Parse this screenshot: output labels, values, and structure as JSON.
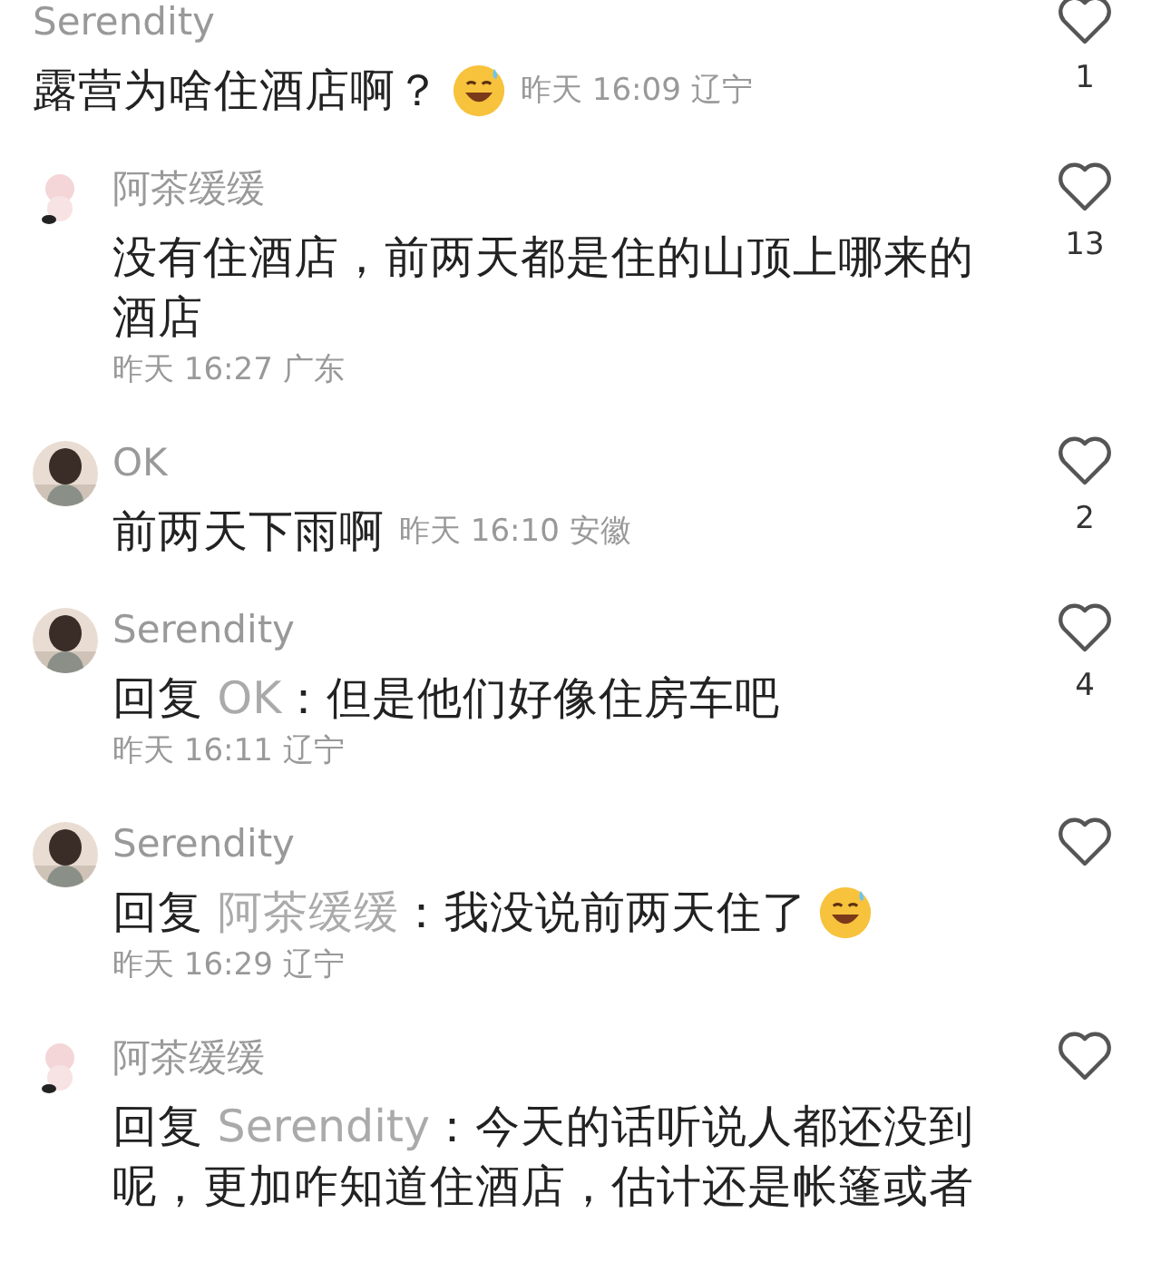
{
  "comments": [
    {
      "name": "Serendity",
      "text": "露营为啥住酒店啊？",
      "emoji": true,
      "time": "昨天 16:09 辽宁",
      "time_inline": true,
      "likes": "1"
    },
    {
      "avatar": {
        "kind": "sticker"
      },
      "name": "阿茶缓缓",
      "text": "没有住酒店，前两天都是住的山顶上哪来的酒店",
      "emoji": false,
      "time": "昨天 16:27 广东",
      "time_inline": false,
      "likes": "13"
    },
    {
      "name": "OK",
      "text": "前两天下雨啊",
      "emoji": false,
      "time": "昨天 16:10 安徽",
      "time_inline": true,
      "likes": "2"
    },
    {
      "name": "Serendity",
      "reply_label": "回复",
      "reply_to": "OK",
      "text": "：但是他们好像住房车吧",
      "emoji": false,
      "time": "昨天 16:11 辽宁",
      "time_inline": false,
      "likes": "4"
    },
    {
      "name": "Serendity",
      "reply_label": "回复",
      "reply_to": "阿茶缓缓",
      "text": "：我没说前两天住了",
      "emoji": true,
      "time": "昨天 16:29 辽宁",
      "time_inline": false
    },
    {
      "avatar": {
        "kind": "sticker"
      },
      "name": "阿茶缓缓",
      "reply_label": "回复",
      "reply_to": "Serendity",
      "text": "：今天的话听说人都还没到呢，更加咋知道住酒店，估计还是帐篷或者",
      "emoji": false
    }
  ]
}
